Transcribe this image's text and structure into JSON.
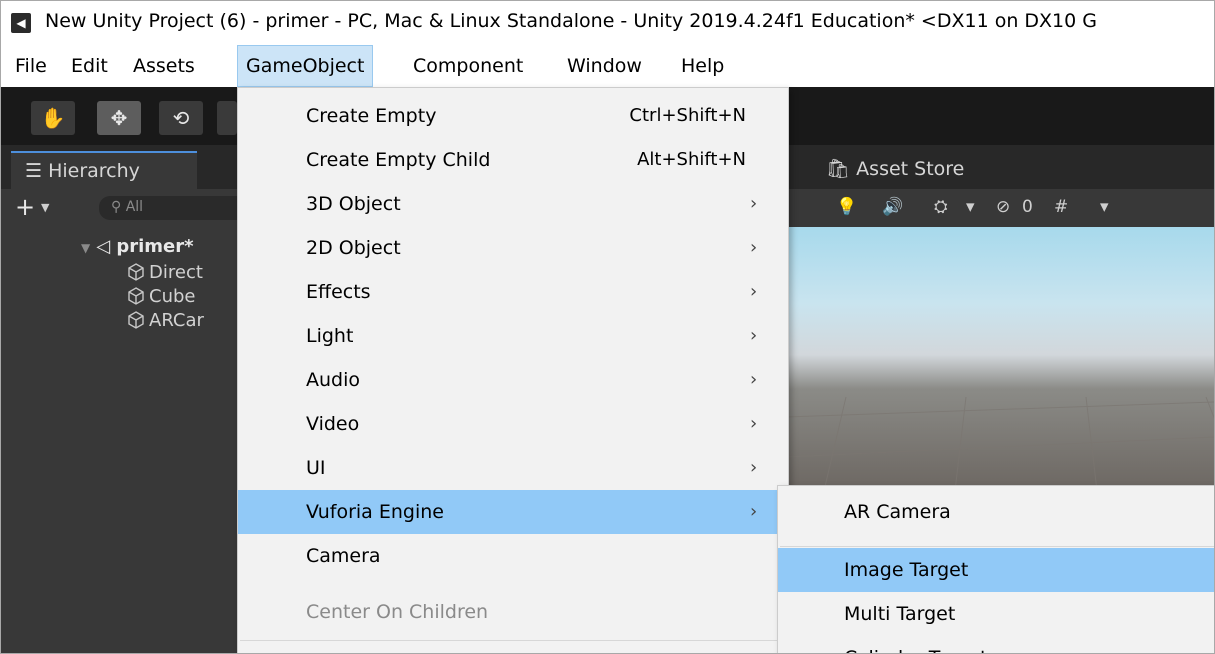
{
  "window": {
    "title": "New Unity Project (6) - primer - PC, Mac & Linux Standalone - Unity 2019.4.24f1 Education* <DX11 on DX10 G"
  },
  "menubar": {
    "items": [
      "File",
      "Edit",
      "Assets",
      "GameObject",
      "Component",
      "Window",
      "Help"
    ],
    "active": "GameObject"
  },
  "toolbar": {
    "tools": [
      "hand-tool",
      "move-tool",
      "rotate-tool"
    ]
  },
  "hierarchy": {
    "tab_label": "Hierarchy",
    "add_label": "+",
    "search_placeholder": "All",
    "scene_name": "primer*",
    "children": [
      "Direct",
      "Cube",
      "ARCar"
    ]
  },
  "scene": {
    "asset_store_label": "Asset Store",
    "hidden_count": "0"
  },
  "gameobject_menu": {
    "items": [
      {
        "label": "Create Empty",
        "shortcut": "Ctrl+Shift+N",
        "submenu": false,
        "highlighted": false,
        "disabled": false
      },
      {
        "label": "Create Empty Child",
        "shortcut": "Alt+Shift+N",
        "submenu": false,
        "highlighted": false,
        "disabled": false
      },
      {
        "label": "3D Object",
        "shortcut": "",
        "submenu": true,
        "highlighted": false,
        "disabled": false
      },
      {
        "label": "2D Object",
        "shortcut": "",
        "submenu": true,
        "highlighted": false,
        "disabled": false
      },
      {
        "label": "Effects",
        "shortcut": "",
        "submenu": true,
        "highlighted": false,
        "disabled": false
      },
      {
        "label": "Light",
        "shortcut": "",
        "submenu": true,
        "highlighted": false,
        "disabled": false
      },
      {
        "label": "Audio",
        "shortcut": "",
        "submenu": true,
        "highlighted": false,
        "disabled": false
      },
      {
        "label": "Video",
        "shortcut": "",
        "submenu": true,
        "highlighted": false,
        "disabled": false
      },
      {
        "label": "UI",
        "shortcut": "",
        "submenu": true,
        "highlighted": false,
        "disabled": false
      },
      {
        "label": "Vuforia Engine",
        "shortcut": "",
        "submenu": true,
        "highlighted": true,
        "disabled": false
      },
      {
        "label": "Camera",
        "shortcut": "",
        "submenu": false,
        "highlighted": false,
        "disabled": false
      },
      {
        "label": "Center On Children",
        "shortcut": "",
        "submenu": false,
        "highlighted": false,
        "disabled": true
      }
    ]
  },
  "vuforia_submenu": {
    "items": [
      {
        "label": "AR Camera",
        "highlighted": false
      },
      {
        "label": "Image Target",
        "highlighted": true
      },
      {
        "label": "Multi Target",
        "highlighted": false
      },
      {
        "label": "Cylinder Target",
        "highlighted": false
      }
    ]
  },
  "colors": {
    "menu_highlight": "#91c9f7",
    "menubar_active": "#cce4f7",
    "editor_dark": "#191919",
    "panel": "#383838"
  }
}
